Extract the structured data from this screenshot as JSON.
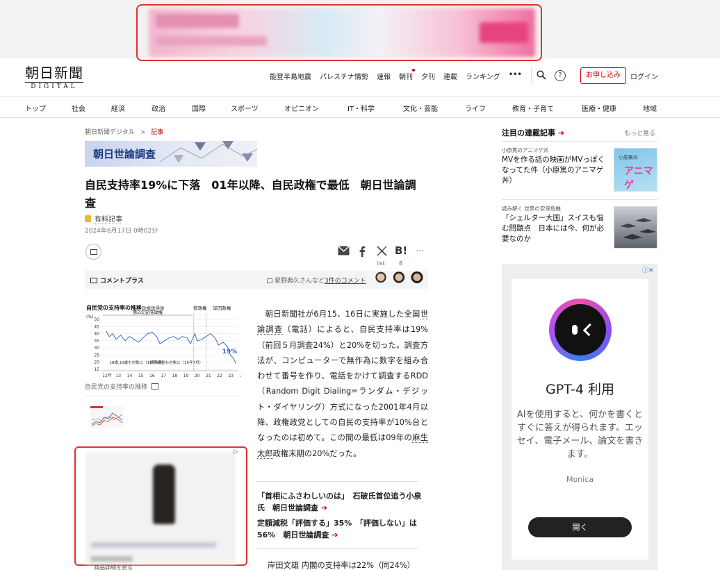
{
  "top_ad": {
    "brand": "Amazon"
  },
  "header": {
    "logo_main": "朝日新聞",
    "logo_sub": "DIGITAL",
    "topnav": [
      "能登半島地震",
      "パレスチナ情勢",
      "速報",
      "朝刊",
      "夕刊",
      "連載",
      "ランキング",
      "•••"
    ],
    "help": "?",
    "subscribe": "お申し込み",
    "login": "ログイン"
  },
  "catnav": [
    "トップ",
    "社会",
    "経済",
    "政治",
    "国際",
    "スポーツ",
    "オピニオン",
    "IT・科学",
    "文化・芸能",
    "ライフ",
    "教育・子育て",
    "医療・健康",
    "地域"
  ],
  "article": {
    "breadcrumb_home": "朝日新聞デジタル",
    "breadcrumb_sep": ">",
    "breadcrumb_current": "記事",
    "banner": "朝日世論調査",
    "headline": "自民支持率19%に下落　01年以降、自民政権で最低　朝日世論調査",
    "paid": "有料記事",
    "date": "2024年6月17日 0時02分",
    "share_list": "list",
    "share_count": "8",
    "comment_plus": "コメントプラス",
    "comment_info_prefix": "星野典久さんなど",
    "comment_info_link": "3件のコメント",
    "chart_caption": "自民党の支持率の推移",
    "body_before1": "　朝日新聞社が6月15、16日に実施した全国",
    "body_link1": "世論調査",
    "body_mid1": "（電話）によると、自民支持率は19%（前回５月調査24%）と20%を切った。調査方法が、コンピューターで無作為に数字を組み合わせて番号を作り、電話をかけて調査するRDD（Random Digit Dialing=ランダム・デジット・ダイヤリング）方式になった2001年4月以降、政権政党としての自民の支持率が10%台となったのは初めて。この間の最低は09年の",
    "body_link2": "麻生太郎",
    "body_after": "政権末期の20%だった。",
    "related1": "「首相にふさわしいのは」　石破氏首位追う小泉氏　朝日世論調査",
    "related2": "定額減税「評価する」35%　「評価しない」は56%　朝日世論調査",
    "body2": "岸田文雄 内閣の支持率は22%（同24%）"
  },
  "left_ad": {
    "under_text": "商品詳細を見る"
  },
  "chart_data": {
    "type": "line",
    "title": "自民党の支持率の推移",
    "subtitle": "政権復帰後",
    "ylabel": "(%)",
    "y_ticks": [
      "50",
      "45",
      "40",
      "35",
      "30",
      "25",
      "20",
      "15"
    ],
    "ylim": [
      15,
      50
    ],
    "x_ticks": [
      "12年",
      "13",
      "14",
      "15",
      "16",
      "17",
      "18",
      "19",
      "20",
      "21",
      "22",
      "23",
      "24"
    ],
    "eras": [
      "第2次安倍政権",
      "菅政権",
      "岸田政権"
    ],
    "annotations": [
      "18歳,19歳も対象に（16年6月）",
      "携帯電話も対象に（16年7月）"
    ],
    "end_label": "19%",
    "series": [
      {
        "x": [
          2012.9,
          2013.2,
          2013.5,
          2013.8,
          2014.2,
          2014.6,
          2015.0,
          2015.4,
          2015.8,
          2016.2,
          2016.6,
          2017.0,
          2017.4,
          2017.7,
          2018.1,
          2018.5,
          2018.9,
          2019.3,
          2019.7,
          2020.1,
          2020.4,
          2020.8,
          2021.0,
          2021.4,
          2021.8,
          2022.2,
          2022.6,
          2022.9,
          2023.3,
          2023.7,
          2023.95,
          2024.2,
          2024.45
        ],
        "values": [
          42,
          38,
          40,
          36,
          39,
          35,
          38,
          36,
          34,
          37,
          40,
          41,
          38,
          33,
          35,
          37,
          38,
          36,
          38,
          37,
          33,
          40,
          35,
          36,
          38,
          40,
          37,
          32,
          34,
          31,
          25,
          23,
          19
        ]
      }
    ]
  },
  "sidebar": {
    "head": "注目の連載記事",
    "more": "もっと見る",
    "items": [
      {
        "category": "小原篤のアニマゲ丼",
        "title": "MVを作る話の映画がMVっぽくなってた件（小原篤のアニマゲ丼）",
        "img_text_small": "小原篤の",
        "img_text_big": "アニマゲ"
      },
      {
        "category": "読み解く 世界の安保危機",
        "title": "「シェルター大国」スイスも悩む問題点　日本には今、何が必要なのか"
      }
    ]
  },
  "monica": {
    "title": "GPT-4 利用",
    "desc": "AIを使用すると、何かを書くとすぐに答えが得られます。エッセイ、電子メール、論文を書きます。",
    "brand": "Monica",
    "button": "開く",
    "ad_icons": "ⓘ✕"
  },
  "colors": {
    "accent_red": "#c00000",
    "link_blue": "#1a73c8",
    "chart_line": "#3b6bbf",
    "banner_text": "#1f3a85"
  }
}
